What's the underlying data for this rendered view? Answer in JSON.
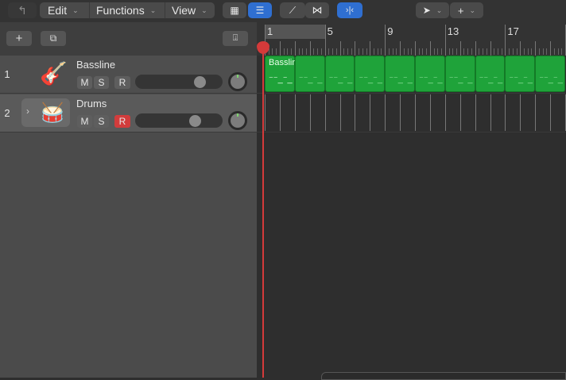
{
  "toolbar": {
    "back_icon": "back-arrow-icon",
    "edit": "Edit",
    "functions": "Functions",
    "view": "View",
    "grid_icon": "grid-icon",
    "list_icon": "list-view-icon",
    "automation_icon": "automation-icon",
    "crossfade_icon": "crossfade-icon",
    "snap_icon": "snap-icon",
    "pointer_icon": "pointer-tool-icon",
    "crosshair_icon": "crosshair-tool-icon"
  },
  "track_header": {
    "add_label": "+"
  },
  "ruler": {
    "bars": [
      "1",
      "5",
      "9",
      "13",
      "17"
    ]
  },
  "tracks": [
    {
      "number": "1",
      "name": "Bassline",
      "icon": "bass-guitar-icon",
      "mute": "M",
      "solo": "S",
      "record": "R",
      "record_armed": false,
      "volume": 0.75,
      "pan": 0
    },
    {
      "number": "2",
      "name": "Drums",
      "icon": "snare-drum-icon",
      "mute": "M",
      "solo": "S",
      "record": "R",
      "record_armed": true,
      "volume": 0.7,
      "pan": 0
    }
  ],
  "regions": [
    {
      "name": "Bassline",
      "color": "#1fa33a",
      "start_bar": 1,
      "loop_bars": 2
    }
  ],
  "colors": {
    "accent": "#2f6fd1",
    "playhead": "#d43a3a",
    "record": "#d23c3c"
  }
}
